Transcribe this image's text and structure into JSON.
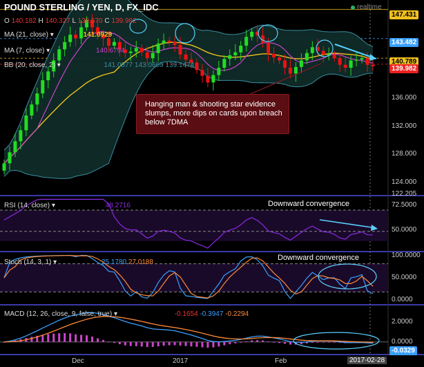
{
  "title": "POUND STERLING / YEN, D, FX_IDC",
  "realtime_label": "realtime",
  "ohlc": {
    "o_label": "O",
    "o": "140.182",
    "h_label": "H",
    "h": "140.327",
    "l_label": "L",
    "l": "139.670",
    "c_label": "C",
    "c": "139.982"
  },
  "indicators": {
    "ma21": {
      "label": "MA (21, close)",
      "value": "141.0929"
    },
    "ma7": {
      "label": "MA (7, close)",
      "value": "140.6794"
    },
    "bb": {
      "label": "BB (20, close, 2)",
      "upper": "141.0877",
      "middle": "143.0669",
      "lower": "139.1474"
    },
    "rsi": {
      "label": "RSI (14, close)",
      "value": "48.2716"
    },
    "stoch": {
      "label": "Stoch (14, 3, 1)",
      "k": "25.1780",
      "d": "27.0188"
    },
    "macd": {
      "label": "MACD (12, 26, close, 9, false, true)",
      "macd": "-0.1654",
      "signal": "-0.3947",
      "hist": "-0.2294"
    }
  },
  "annotation": "Hanging man & shooting star evidence slumps, more dips on cards upon breach below 7DMA",
  "rsi_note": "Downward convergence",
  "stoch_note": "Downward convergence",
  "price_axis": {
    "ticks": [
      "136.000",
      "132.000",
      "128.000",
      "124.000"
    ],
    "tag_high": "147.431",
    "tag_upper": "143.482",
    "tag_mid": "140.789",
    "tag_close": "139.982",
    "tag_low": "122.205"
  },
  "rsi_axis": [
    "72.5000",
    "50.0000"
  ],
  "stoch_axis": [
    "100.0000",
    "50.0000",
    "0.0000"
  ],
  "macd_axis": [
    "2.0000",
    "0.0000",
    "-0.0329"
  ],
  "x_axis": [
    "Dec",
    "2017",
    "Feb",
    "2017-02-28"
  ],
  "colors": {
    "up": "#22dd22",
    "down": "#ee1111",
    "ma21": "#f0c020",
    "ma7": "#cc44cc",
    "bb": "#3a8fa0",
    "bbfill": "#0f2d2a",
    "rsi": "#8a2be2",
    "stochK": "#3aa0ff",
    "stochD": "#ff8a3a",
    "macd": "#3aa0ff",
    "signal": "#ff8a3a",
    "hist": "#cc44cc",
    "cyan": "#5ad0ff",
    "closeTag": "#ee2222",
    "yellowTag": "#f0c020",
    "blueTag": "#3aa0ff"
  },
  "chart_data": [
    {
      "type": "candlestick",
      "title": "POUND STERLING / YEN, D, FX_IDC",
      "x_range": [
        "2016-11-18",
        "2017-02-28"
      ],
      "ylim": [
        122.2,
        147.4
      ],
      "close": [
        126.5,
        128,
        129.5,
        131,
        133,
        134.5,
        136,
        137.8,
        139,
        140.5,
        142,
        143,
        144,
        143.5,
        145,
        146,
        145,
        144,
        143.5,
        142.5,
        143,
        142,
        141.5,
        141.7,
        142.2,
        141.6,
        140.8,
        141.5,
        142.8,
        143.2,
        143,
        142.6,
        141.3,
        140.6,
        140.2,
        139.2,
        138.4,
        137.5,
        138.5,
        139.5,
        140.7,
        141.2,
        141.6,
        142.5,
        143.7,
        144.4,
        143.9,
        142.9,
        141.4,
        140.9,
        140.5,
        139.5,
        138.7,
        139.6,
        140.5,
        141.5,
        142.3,
        141.8,
        141.3,
        141.3,
        140.8,
        139.9,
        139.5,
        140.5,
        140.6,
        140.8,
        139.9,
        139.7
      ],
      "ma21_end": 141.0929,
      "ma7_end": 140.6794,
      "bb_end": {
        "upper": 141.0877,
        "middle": 143.0669,
        "lower": 139.1474
      }
    },
    {
      "type": "line",
      "name": "RSI (14, close)",
      "ylim": [
        30,
        85
      ],
      "last": 48.2716
    },
    {
      "type": "line",
      "name": "Stoch (14, 3, 1)",
      "ylim": [
        0,
        100
      ],
      "last_k": 25.178,
      "last_d": 27.0188
    },
    {
      "type": "line",
      "name": "MACD (12, 26, close, 9, false, true)",
      "ylim": [
        -1,
        3
      ],
      "last_macd": -0.1654,
      "last_signal": -0.3947,
      "last_hist": -0.2294
    }
  ]
}
